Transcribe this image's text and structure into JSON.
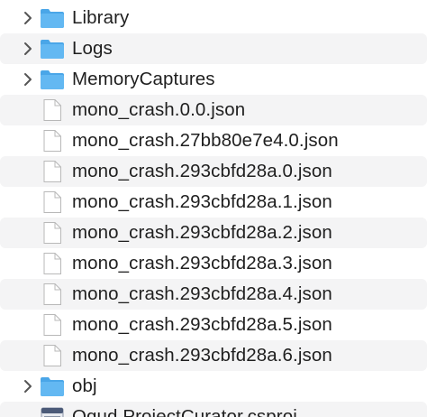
{
  "items": [
    {
      "type": "folder",
      "name": "Library"
    },
    {
      "type": "folder",
      "name": "Logs"
    },
    {
      "type": "folder",
      "name": "MemoryCaptures"
    },
    {
      "type": "file",
      "name": "mono_crash.0.0.json"
    },
    {
      "type": "file",
      "name": "mono_crash.27bb80e7e4.0.json"
    },
    {
      "type": "file",
      "name": "mono_crash.293cbfd28a.0.json"
    },
    {
      "type": "file",
      "name": "mono_crash.293cbfd28a.1.json"
    },
    {
      "type": "file",
      "name": "mono_crash.293cbfd28a.2.json"
    },
    {
      "type": "file",
      "name": "mono_crash.293cbfd28a.3.json"
    },
    {
      "type": "file",
      "name": "mono_crash.293cbfd28a.4.json"
    },
    {
      "type": "file",
      "name": "mono_crash.293cbfd28a.5.json"
    },
    {
      "type": "file",
      "name": "mono_crash.293cbfd28a.6.json"
    },
    {
      "type": "folder",
      "name": "obj"
    },
    {
      "type": "project",
      "name": "Oqud.ProjectCurator.csproj"
    }
  ],
  "colors": {
    "folder": "#5eb4f0",
    "folder_tab": "#4aa6e8",
    "alt_row": "#f4f4f5",
    "chevron": "#555555"
  },
  "icons": {
    "disclosure": "chevron-right-icon",
    "folder": "folder-icon",
    "file": "document-icon",
    "project": "csproj-file-icon"
  }
}
